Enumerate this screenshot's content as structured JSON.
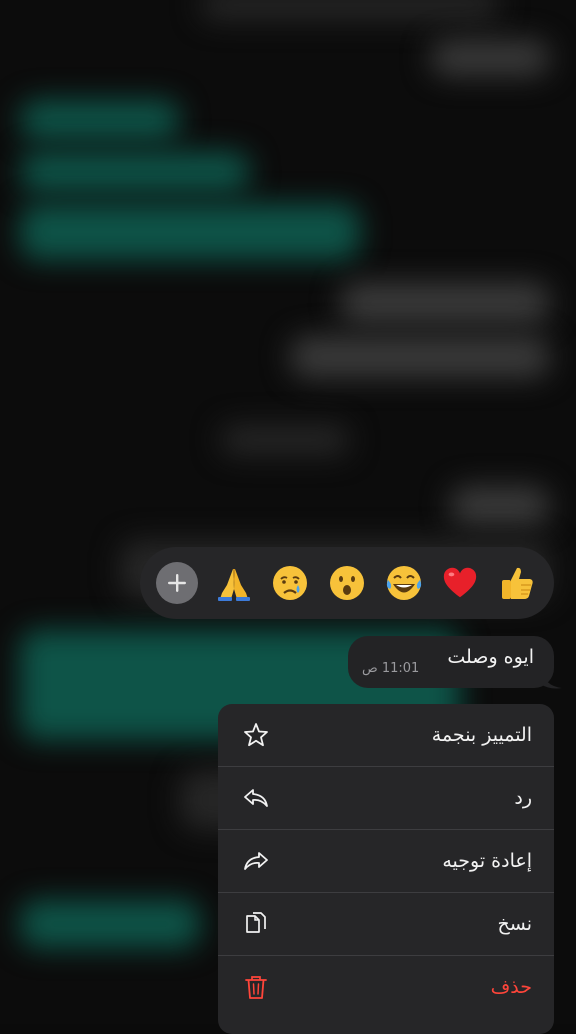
{
  "reactions": {
    "items": [
      {
        "name": "thumbs-up",
        "glyph": "👍"
      },
      {
        "name": "red-heart",
        "glyph": "❤️"
      },
      {
        "name": "tears-of-joy",
        "glyph": "😂"
      },
      {
        "name": "surprised",
        "glyph": "😮"
      },
      {
        "name": "crying",
        "glyph": "😢"
      },
      {
        "name": "folded-hands",
        "glyph": "🙏"
      }
    ],
    "add_icon": "plus-icon"
  },
  "message": {
    "text": "ايوه وصلت",
    "time": "11:01 ص"
  },
  "menu": {
    "items": [
      {
        "label": "التمييز بنجمة",
        "icon": "star-icon"
      },
      {
        "label": "رد",
        "icon": "reply-icon"
      },
      {
        "label": "إعادة توجيه",
        "icon": "forward-icon"
      },
      {
        "label": "نسخ",
        "icon": "copy-icon"
      },
      {
        "label": "حذف",
        "icon": "trash-icon",
        "color": "#ff453a"
      }
    ]
  },
  "colors": {
    "background": "#0b0b0b",
    "panel": "#262628",
    "bubble": "#232325",
    "danger": "#ff453a",
    "outgoing_green": "#0e5448"
  }
}
